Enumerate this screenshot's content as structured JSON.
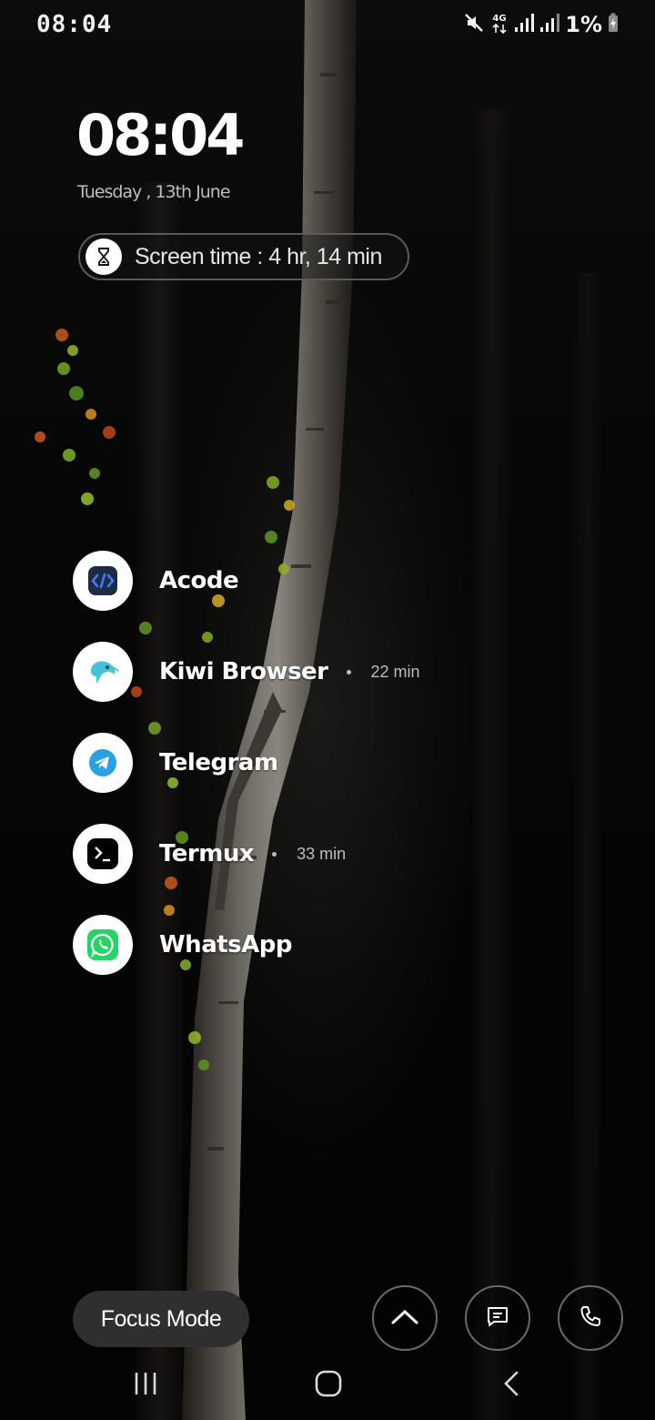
{
  "status_bar": {
    "time": "08:04",
    "network_label": "4G",
    "battery": "1%",
    "icons": [
      "mute-icon",
      "network-4g-icon",
      "signal-icon",
      "signal-icon",
      "battery-charging-icon"
    ]
  },
  "home": {
    "clock": "08:04",
    "date": "Tuesday , 13th June",
    "screen_time": "Screen time : 4 hr, 14 min"
  },
  "apps": [
    {
      "name": "Acode",
      "usage": "",
      "icon": "acode-icon",
      "color": "#2f5bd9"
    },
    {
      "name": "Kiwi Browser",
      "usage": "22 min",
      "icon": "kiwi-icon",
      "color": "#2fb6c9"
    },
    {
      "name": "Telegram",
      "usage": "",
      "icon": "telegram-icon",
      "color": "#2aa1e0"
    },
    {
      "name": "Termux",
      "usage": "33 min",
      "icon": "termux-icon",
      "color": "#000000"
    },
    {
      "name": "WhatsApp",
      "usage": "",
      "icon": "whatsapp-icon",
      "color": "#26d367"
    }
  ],
  "controls": {
    "focus_mode": "Focus Mode",
    "buttons": [
      "chevron-up-icon",
      "message-icon",
      "phone-icon"
    ]
  },
  "nav": [
    "recents-icon",
    "home-icon",
    "back-icon"
  ]
}
